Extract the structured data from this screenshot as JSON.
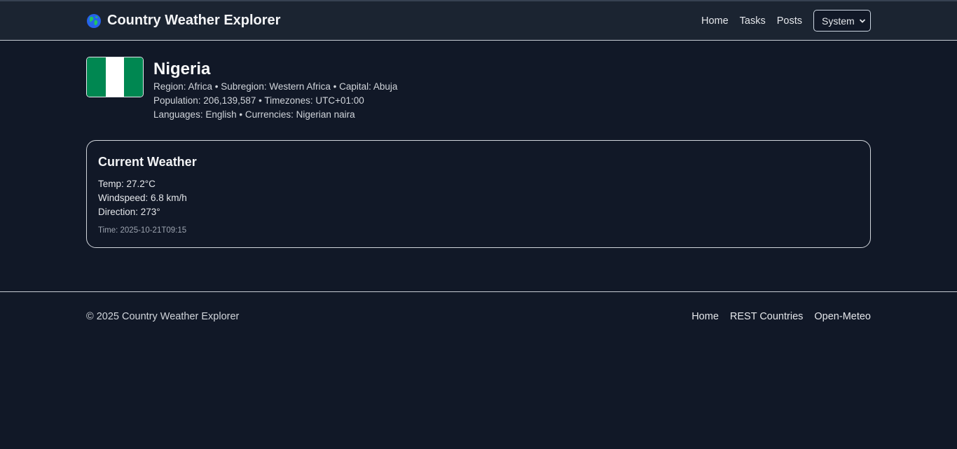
{
  "header": {
    "icon": "globe-icon",
    "title": "Country Weather Explorer",
    "nav": [
      "Home",
      "Tasks",
      "Posts"
    ],
    "theme_select": {
      "value": "System",
      "options": [
        "System"
      ]
    }
  },
  "country": {
    "name": "Nigeria",
    "flag_colors": [
      "#008751",
      "#ffffff",
      "#008751"
    ],
    "line1": "Region: Africa • Subregion: Western Africa • Capital: Abuja",
    "line2": "Population: 206,139,587 • Timezones: UTC+01:00",
    "line3": "Languages: English • Currencies: Nigerian naira"
  },
  "weather": {
    "title": "Current Weather",
    "temp": "Temp: 27.2°C",
    "windspeed": "Windspeed: 6.8 km/h",
    "direction": "Direction: 273°",
    "time": "Time: 2025-10-21T09:15"
  },
  "footer": {
    "copyright": "© 2025 Country Weather Explorer",
    "links": [
      "Home",
      "REST Countries",
      "Open-Meteo"
    ]
  }
}
